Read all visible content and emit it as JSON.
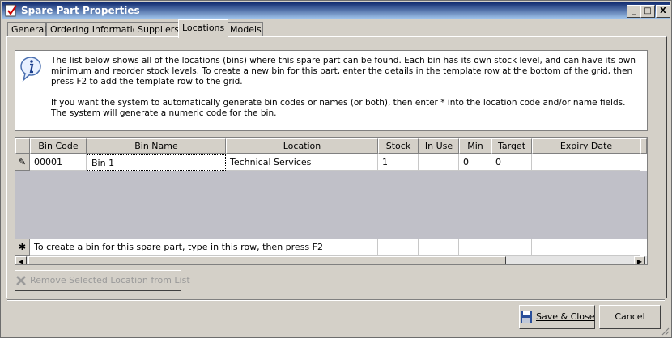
{
  "window": {
    "title": "Spare Part Properties"
  },
  "tabs": [
    {
      "label": "General"
    },
    {
      "label": "Ordering Information"
    },
    {
      "label": "Suppliers"
    },
    {
      "label": "Locations",
      "active": true
    },
    {
      "label": "Models"
    }
  ],
  "info": {
    "paragraph1": "The list below shows all of the locations (bins) where this spare part can be found. Each bin has its own stock level, and can have its own minimum and reorder stock levels. To create a new bin for this part, enter the details in the template row at the bottom of the grid, then press F2 to add the template row to the grid.",
    "paragraph2": "If you want the system to automatically generate bin codes or names (or both), then enter * into the location code and/or name fields. The system will generate a numeric code for the bin."
  },
  "grid": {
    "columns": [
      "Bin Code",
      "Bin Name",
      "Location",
      "Stock",
      "In Use",
      "Min",
      "Target",
      "Expiry Date"
    ],
    "rows": [
      {
        "bin_code": "00001",
        "bin_name": "Bin 1",
        "location": "Technical Services",
        "stock": "1",
        "in_use": "",
        "min": "0",
        "target": "0",
        "expiry_date": ""
      }
    ],
    "template_row_text": "To create a bin for this spare part, type in this row, then press F2",
    "row_selector_symbol": "✎",
    "template_selector_symbol": "✱"
  },
  "buttons": {
    "remove_label": "Remove Selected Location from List",
    "save_label": "Save & Close",
    "cancel_label": "Cancel"
  },
  "titlebar_buttons": {
    "minimize": "_",
    "maximize": "□",
    "close": "X"
  },
  "colors": {
    "title_start": "#0a246a",
    "title_end": "#a6caf0",
    "grid_empty": "#c0c0c8"
  }
}
